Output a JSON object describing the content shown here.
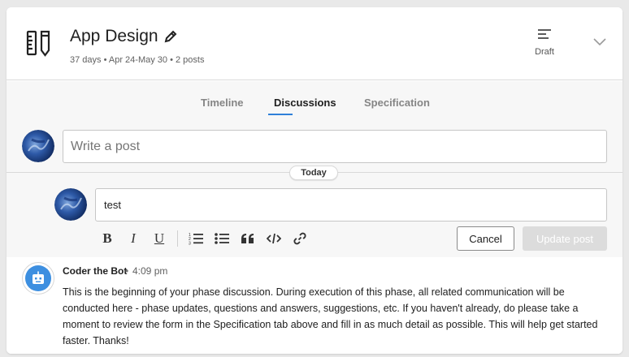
{
  "header": {
    "title": "App Design",
    "meta": "37 days • Apr 24-May 30 • 2 posts",
    "status_label": "Draft",
    "icons": {
      "project": "ruler-pencil-icon",
      "edit": "pencil-icon",
      "status": "align-left-icon",
      "expand": "chevron-down-icon"
    }
  },
  "tabs": [
    {
      "label": "Timeline",
      "active": false
    },
    {
      "label": "Discussions",
      "active": true
    },
    {
      "label": "Specification",
      "active": false
    }
  ],
  "composer": {
    "placeholder": "Write a post"
  },
  "date_separator": "Today",
  "edit_post": {
    "value": "test",
    "toolbar": [
      "B",
      "I",
      "U",
      "numbered-list-icon",
      "bulleted-list-icon",
      "quote-icon",
      "code-icon",
      "link-icon"
    ],
    "cancel_label": "Cancel",
    "update_label": "Update post"
  },
  "post": {
    "author": "Coder the Bot",
    "separator": "•",
    "time": "4:09 pm",
    "text": "This is the beginning of your phase discussion. During execution of this phase, all related communication will be conducted here - phase updates, questions and answers, suggestions, etc. If you haven't already, do please take a moment to review the form in the Specification tab above and fill in as much detail as possible. This will help get started faster. Thanks!"
  },
  "colors": {
    "accent": "#2f80d9",
    "bot_avatar": "#3d8fe0",
    "disabled_button": "#dcdcdc",
    "background": "#e9e9e9"
  }
}
